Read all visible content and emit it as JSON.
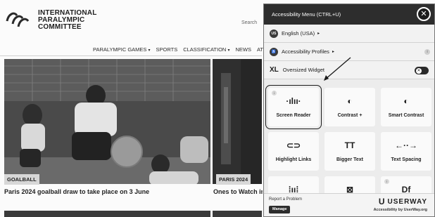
{
  "site": {
    "logo_lines": [
      "INTERNATIONAL",
      "PARALYMPIC",
      "COMMITTEE"
    ],
    "search_label": "Search",
    "nav": [
      {
        "label": "PARALYMPIC GAMES",
        "caret": true
      },
      {
        "label": "SPORTS",
        "caret": false
      },
      {
        "label": "CLASSIFICATION",
        "caret": true
      },
      {
        "label": "NEWS",
        "caret": false
      },
      {
        "label": "ATHLETES",
        "caret": false
      }
    ],
    "caret_glyph": "▾",
    "articles": [
      {
        "tag": "GOALBALL",
        "headline": "Paris 2024 goalball draw to take place on 3 June"
      },
      {
        "tag": "PARIS 2024",
        "headline": "Ones to Watch in"
      }
    ]
  },
  "panel": {
    "title": "Accessibility Menu (CTRL+U)",
    "close_glyph": "✕",
    "language": {
      "badge": "US",
      "label": "English (USA)",
      "arrow": "▸"
    },
    "profiles": {
      "label": "Accessibility Profiles",
      "arrow": "▸",
      "info": "i"
    },
    "oversized": {
      "prefix": "XL",
      "label": "Oversized Widget",
      "toggle_glyph": "✕",
      "enabled": false
    },
    "cards": [
      {
        "label": "Screen Reader",
        "glyph": "·ılıı·",
        "icon": "waveform-icon",
        "info": "i",
        "selected": true
      },
      {
        "label": "Contrast +",
        "glyph": "◐",
        "icon": "contrast-icon",
        "info": "",
        "selected": false
      },
      {
        "label": "Smart Contrast",
        "glyph": "◐",
        "icon": "smart-contrast-icon",
        "info": "",
        "selected": false
      },
      {
        "label": "Highlight Links",
        "glyph": "⊂⊃",
        "icon": "link-icon",
        "info": "",
        "selected": false
      },
      {
        "label": "Bigger Text",
        "glyph": "TT",
        "icon": "text-size-icon",
        "info": "",
        "selected": false
      },
      {
        "label": "Text Spacing",
        "glyph": "←··→",
        "icon": "text-spacing-icon",
        "info": "",
        "selected": false
      },
      {
        "label": "",
        "glyph": "⁞ıı⁞",
        "icon": "pause-animations-icon",
        "info": "",
        "selected": false
      },
      {
        "label": "",
        "glyph": "⊠",
        "icon": "hide-images-icon",
        "info": "",
        "selected": false
      },
      {
        "label": "",
        "glyph": "Df",
        "icon": "dyslexia-font-icon",
        "info": "i",
        "selected": false
      }
    ],
    "footer": {
      "report": "Report a Problem",
      "manage": "Manage",
      "brand": "USERWAY",
      "brand_mark": "U",
      "byline": "Accessibility by UserWay.org"
    }
  }
}
